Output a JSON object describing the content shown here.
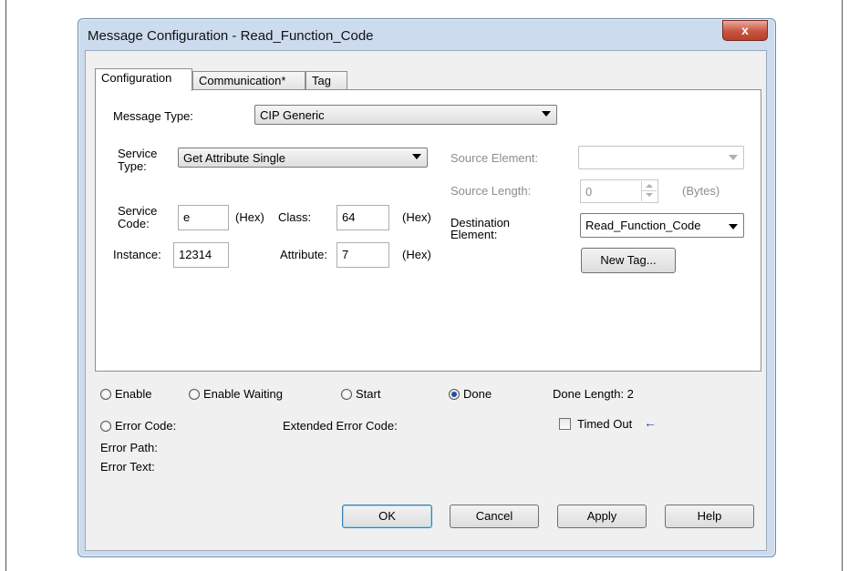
{
  "window": {
    "title": "Message Configuration - Read_Function_Code",
    "close_glyph": "x"
  },
  "tabs": [
    {
      "label": "Configuration"
    },
    {
      "label": "Communication*"
    },
    {
      "label": "Tag"
    }
  ],
  "config": {
    "message_type_label": "Message Type:",
    "message_type_value": "CIP Generic",
    "service_type_label_1": "Service",
    "service_type_label_2": "Type:",
    "service_type_value": "Get Attribute Single",
    "service_code_label_1": "Service",
    "service_code_label_2": "Code:",
    "service_code_value": "e",
    "hex": "(Hex)",
    "class_label": "Class:",
    "class_value": "64",
    "instance_label": "Instance:",
    "instance_value": "12314",
    "attribute_label": "Attribute:",
    "attribute_value": "7",
    "source_element_label": "Source Element:",
    "source_element_value": "",
    "source_length_label": "Source Length:",
    "source_length_value": "0",
    "bytes_label": "(Bytes)",
    "destination_label_1": "Destination",
    "destination_label_2": "Element:",
    "destination_value": "Read_Function_Code",
    "new_tag_label": "New Tag..."
  },
  "status": {
    "enable": "Enable",
    "enable_waiting": "Enable Waiting",
    "start": "Start",
    "done": "Done",
    "done_length": "Done Length: 2",
    "error_code": "Error Code:",
    "extended_error_code": "Extended Error Code:",
    "timed_out": "Timed Out",
    "error_path": "Error Path:",
    "error_text": "Error Text:",
    "done_selected": true,
    "timed_out_checked": false
  },
  "buttons": {
    "ok": "OK",
    "cancel": "Cancel",
    "apply": "Apply",
    "help": "Help"
  },
  "colors": {
    "accent": "#1f4fa8",
    "close": "#c7543f"
  }
}
